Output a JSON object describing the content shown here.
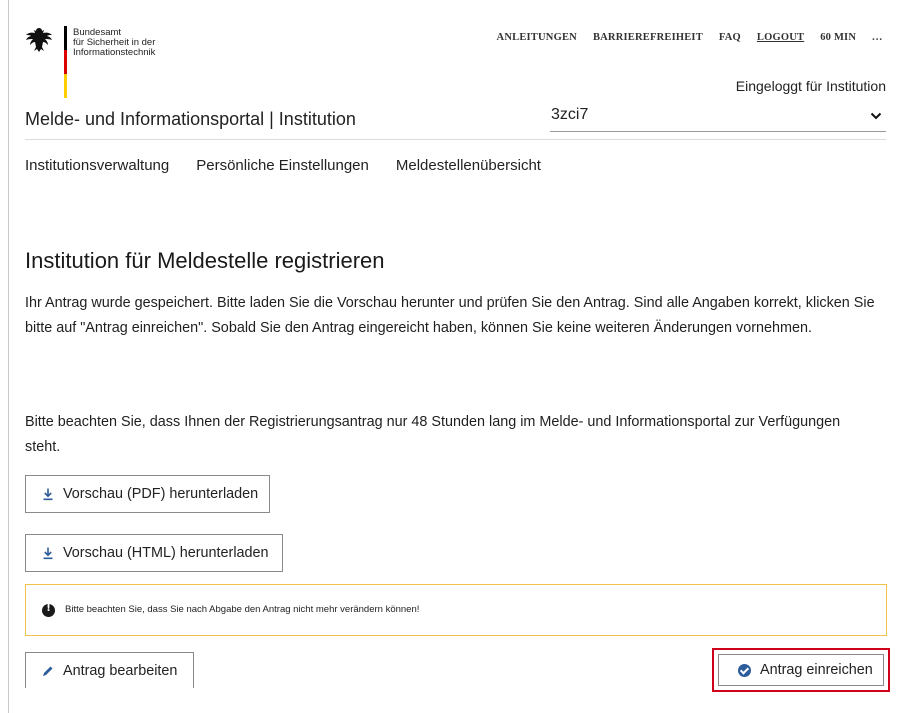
{
  "header": {
    "logo_lines": [
      "Bundesamt",
      "für Sicherheit in der",
      "Informationstechnik"
    ],
    "topnav": {
      "anleitungen": "ANLEITUNGEN",
      "barrierefreiheit": "BARRIEREFREIHEIT",
      "faq": "FAQ",
      "logout": "LOGOUT",
      "session": "60 MIN",
      "more": "..."
    },
    "logged_in": "Eingeloggt für Institution",
    "portal_title": "Melde- und Informationsportal | Institution",
    "institution_select": {
      "value": "3zci7",
      "icon": "chevron-down-icon"
    }
  },
  "mainnav": {
    "items": [
      "Institutionsverwaltung",
      "Persönliche Einstellungen",
      "Meldestellenübersicht"
    ]
  },
  "content": {
    "heading": "Institution für Meldestelle registrieren",
    "paragraph1": "Ihr Antrag wurde gespeichert. Bitte laden Sie die Vorschau herunter und prüfen Sie den Antrag. Sind alle Angaben korrekt, klicken Sie bitte auf \"Antrag einreichen\". Sobald Sie den Antrag eingereicht haben, können Sie keine weiteren Änderungen vornehmen.",
    "paragraph2": "Bitte beachten Sie, dass Ihnen der Registrierungsantrag nur 48 Stunden lang im Melde- und Informationsportal zur Verfügungen steht.",
    "btn_pdf": "Vorschau (PDF) herunterladen",
    "btn_html": "Vorschau (HTML) herunterladen",
    "warning": "Bitte beachten Sie, dass Sie nach Abgabe den Antrag nicht mehr verändern können!",
    "btn_edit": "Antrag bearbeiten",
    "btn_submit": "Antrag einreichen"
  },
  "colors": {
    "flag_black": "#000000",
    "flag_red": "#dd0000",
    "flag_gold": "#ffce00",
    "warning_border": "#f0c14b",
    "highlight": "#d0021b",
    "check_blue": "#2c5c9c"
  }
}
